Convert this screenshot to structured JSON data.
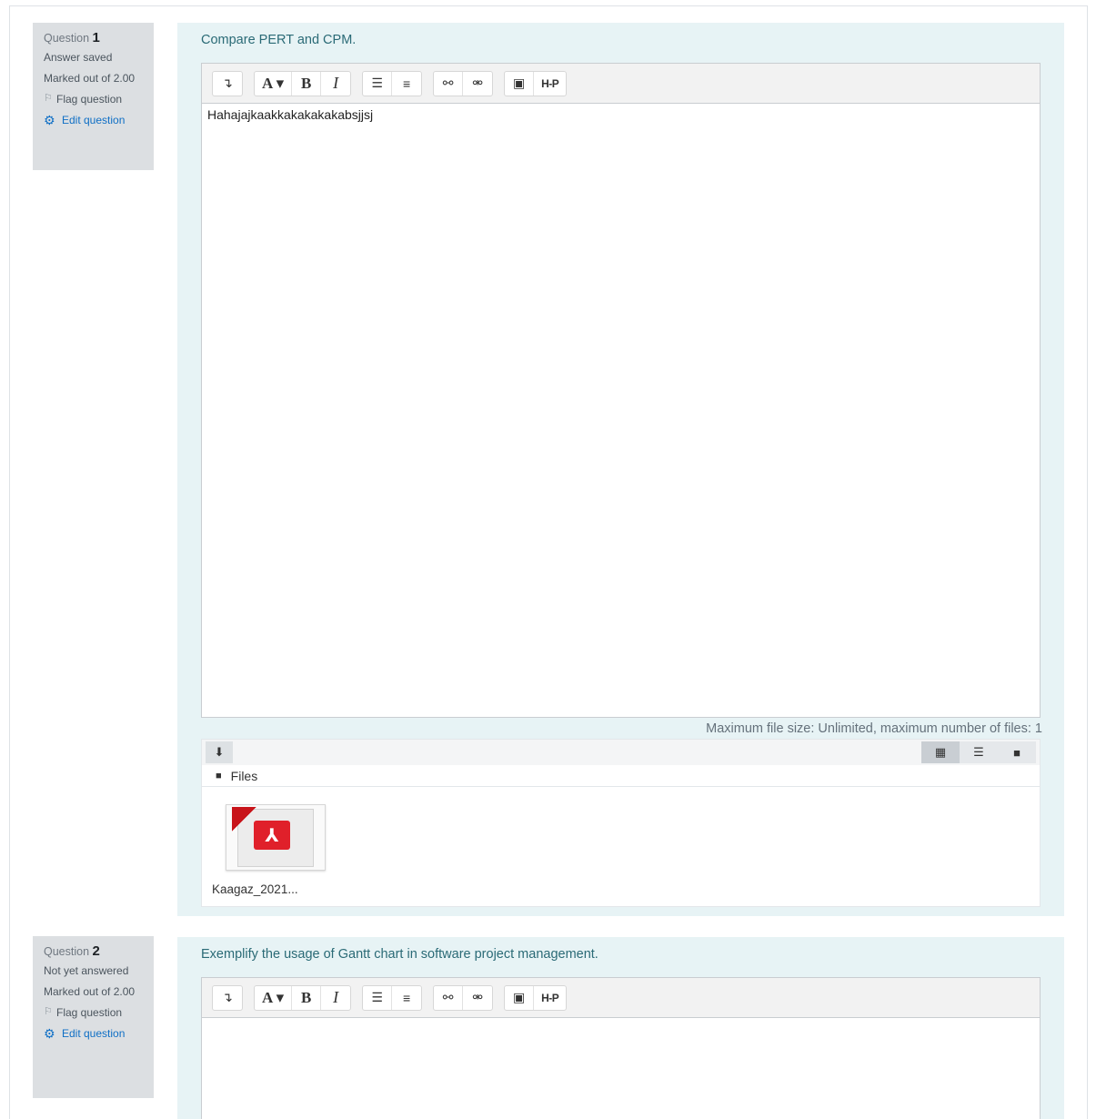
{
  "toolbar": {
    "expand": "↴",
    "font": "A ▾",
    "bold": "B",
    "italic": "I",
    "bullets": "☰",
    "numbers": "≡",
    "link": "⚯",
    "unlink": "⚮",
    "image": "▣",
    "h5p": "H-P"
  },
  "questions": [
    {
      "label": "Question",
      "number": "1",
      "state": "Answer saved",
      "grade": "Marked out of 2.00",
      "flag": "Flag question",
      "edit": "Edit question",
      "text": "Compare PERT and CPM.",
      "answer": "Hahajajkaakkakakakakabsjjsj",
      "filemanager": {
        "limit": "Maximum file size: Unlimited, maximum number of files: 1",
        "path": "Files",
        "files": [
          {
            "name": "Kaagaz_2021..."
          }
        ]
      }
    },
    {
      "label": "Question",
      "number": "2",
      "state": "Not yet answered",
      "grade": "Marked out of 2.00",
      "flag": "Flag question",
      "edit": "Edit question",
      "text": "Exemplify the usage of Gantt chart in software project management.",
      "answer": ""
    }
  ]
}
